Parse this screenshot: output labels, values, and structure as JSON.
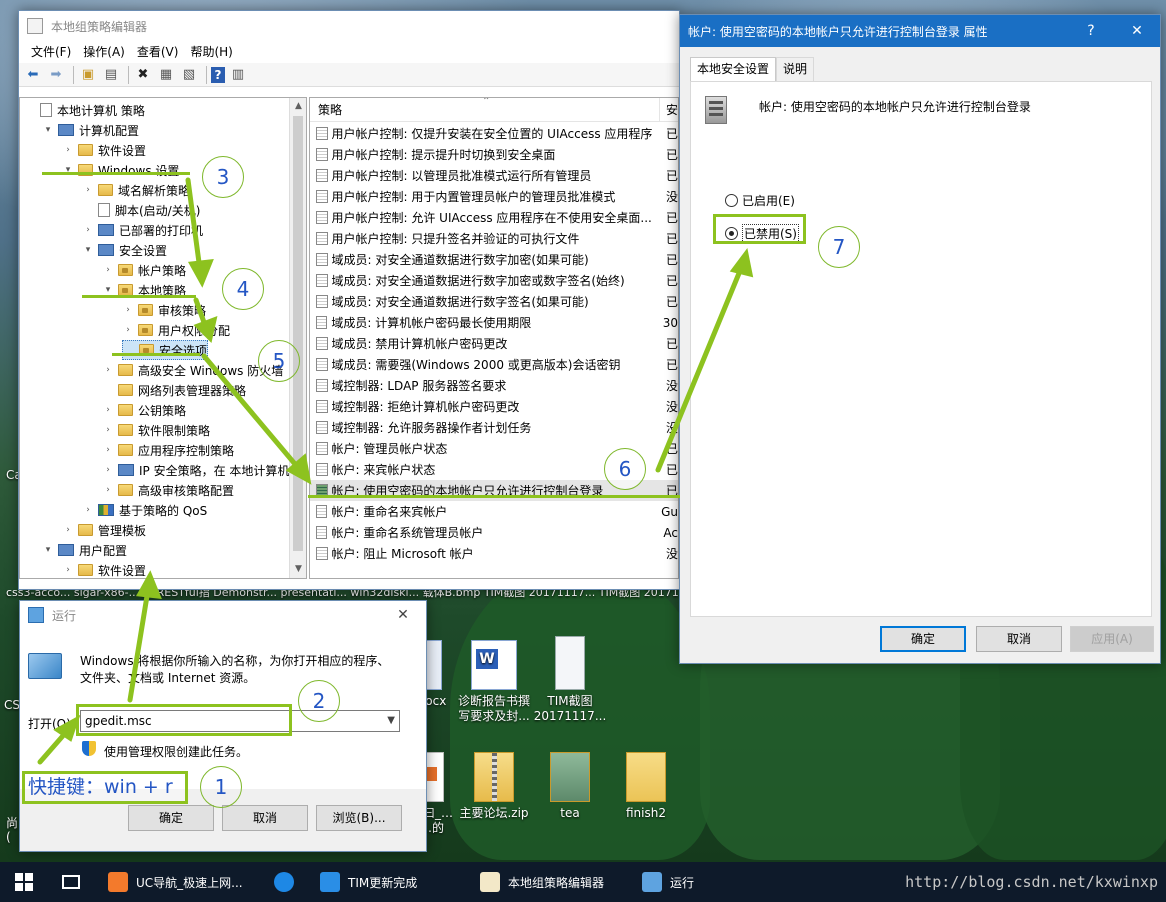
{
  "desktop": {
    "edge_labels": [
      "Ca",
      "CS",
      "尚",
      "("
    ],
    "filename_strip": "css3-acco...   sigar-x86-...04.RESTful指 Demonstr...  presentati...   win32diski...  载体B.bmp   TIM截图 20171117...  TIM截图 20171117...",
    "icons": [
      {
        "label": "docx",
        "icon": "word-doc-icon"
      },
      {
        "label": "诊断报告书撰写要求及封...",
        "icon": "word-doc-icon"
      },
      {
        "label": "TIM截图20171117...",
        "icon": "screenshot-icon"
      },
      {
        "label": "…曰_… …的",
        "icon": "pdf-icon"
      },
      {
        "label": "主要论坛.zip",
        "icon": "zip-folder-icon"
      },
      {
        "label": "tea",
        "icon": "image-folder-icon"
      },
      {
        "label": "finish2",
        "icon": "folder-icon"
      }
    ]
  },
  "gpedit": {
    "title": "本地组策略编辑器",
    "menu": [
      "文件(F)",
      "操作(A)",
      "查看(V)",
      "帮助(H)"
    ],
    "toolbar_icons": [
      "back-icon",
      "forward-icon",
      "up-folder-icon",
      "show-hide-tree-icon",
      "delete-icon",
      "properties-icon",
      "export-icon",
      "help-icon",
      "view-icon"
    ],
    "tree": [
      {
        "label": "本地计算机 策略",
        "level": 0,
        "icon": "doc",
        "expander": ""
      },
      {
        "label": "计算机配置",
        "level": 1,
        "icon": "pc",
        "expander": "v"
      },
      {
        "label": "软件设置",
        "level": 2,
        "icon": "folder",
        "expander": ">"
      },
      {
        "label": "Windows 设置",
        "level": 2,
        "icon": "folder",
        "expander": "v"
      },
      {
        "label": "域名解析策略",
        "level": 3,
        "icon": "folder",
        "expander": ">"
      },
      {
        "label": "脚本(启动/关机)",
        "level": 3,
        "icon": "doc",
        "expander": ""
      },
      {
        "label": "已部署的打印机",
        "level": 3,
        "icon": "pc",
        "expander": ">"
      },
      {
        "label": "安全设置",
        "level": 3,
        "icon": "pc",
        "expander": "v"
      },
      {
        "label": "帐户策略",
        "level": 4,
        "icon": "folder-lock",
        "expander": ">"
      },
      {
        "label": "本地策略",
        "level": 4,
        "icon": "folder-lock",
        "expander": "v"
      },
      {
        "label": "审核策略",
        "level": 5,
        "icon": "folder-lock",
        "expander": ">"
      },
      {
        "label": "用户权限分配",
        "level": 5,
        "icon": "folder-lock",
        "expander": ">"
      },
      {
        "label": "安全选项",
        "level": 5,
        "icon": "folder-lock",
        "expander": "",
        "selected": true
      },
      {
        "label": "高级安全 Windows 防火墙",
        "level": 4,
        "icon": "folder",
        "expander": ">"
      },
      {
        "label": "网络列表管理器策略",
        "level": 4,
        "icon": "folder",
        "expander": ""
      },
      {
        "label": "公钥策略",
        "level": 4,
        "icon": "folder",
        "expander": ">"
      },
      {
        "label": "软件限制策略",
        "level": 4,
        "icon": "folder",
        "expander": ">"
      },
      {
        "label": "应用程序控制策略",
        "level": 4,
        "icon": "folder",
        "expander": ">"
      },
      {
        "label": "IP 安全策略，在 本地计算机",
        "level": 4,
        "icon": "pc",
        "expander": ">"
      },
      {
        "label": "高级审核策略配置",
        "level": 4,
        "icon": "folder",
        "expander": ">"
      },
      {
        "label": "基于策略的 QoS",
        "level": 3,
        "icon": "chart",
        "expander": ">"
      },
      {
        "label": "管理模板",
        "level": 2,
        "icon": "folder",
        "expander": ">"
      },
      {
        "label": "用户配置",
        "level": 1,
        "icon": "pc",
        "expander": "v"
      },
      {
        "label": "软件设置",
        "level": 2,
        "icon": "folder",
        "expander": ">"
      }
    ],
    "list_headers": {
      "policy": "策略",
      "setting": "安"
    },
    "policies": [
      {
        "name": "用户帐户控制: 仅提升安装在安全位置的 UIAccess 应用程序",
        "setting": "已"
      },
      {
        "name": "用户帐户控制: 提示提升时切换到安全桌面",
        "setting": "已"
      },
      {
        "name": "用户帐户控制: 以管理员批准模式运行所有管理员",
        "setting": "已"
      },
      {
        "name": "用户帐户控制: 用于内置管理员帐户的管理员批准模式",
        "setting": "没"
      },
      {
        "name": "用户帐户控制: 允许 UIAccess 应用程序在不使用安全桌面...",
        "setting": "已"
      },
      {
        "name": "用户帐户控制: 只提升签名并验证的可执行文件",
        "setting": "已"
      },
      {
        "name": "域成员: 对安全通道数据进行数字加密(如果可能)",
        "setting": "已"
      },
      {
        "name": "域成员: 对安全通道数据进行数字加密或数字签名(始终)",
        "setting": "已"
      },
      {
        "name": "域成员: 对安全通道数据进行数字签名(如果可能)",
        "setting": "已"
      },
      {
        "name": "域成员: 计算机帐户密码最长使用期限",
        "setting": "30"
      },
      {
        "name": "域成员: 禁用计算机帐户密码更改",
        "setting": "已"
      },
      {
        "name": "域成员: 需要强(Windows 2000 或更高版本)会话密钥",
        "setting": "已"
      },
      {
        "name": "域控制器: LDAP 服务器签名要求",
        "setting": "没"
      },
      {
        "name": "域控制器: 拒绝计算机帐户密码更改",
        "setting": "没"
      },
      {
        "name": "域控制器: 允许服务器操作者计划任务",
        "setting": "没"
      },
      {
        "name": "帐户: 管理员帐户状态",
        "setting": "已"
      },
      {
        "name": "帐户: 来宾帐户状态",
        "setting": "已"
      },
      {
        "name": "帐户: 使用空密码的本地帐户只允许进行控制台登录",
        "setting": "已",
        "selected": true
      },
      {
        "name": "帐户: 重命名来宾帐户",
        "setting": "Gu"
      },
      {
        "name": "帐户: 重命名系统管理员帐户",
        "setting": "Ac"
      },
      {
        "name": "帐户: 阻止 Microsoft 帐户",
        "setting": "没"
      }
    ]
  },
  "properties": {
    "title": "帐户: 使用空密码的本地帐户只允许进行控制台登录 属性",
    "help_glyph": "?",
    "close_glyph": "✕",
    "tabs": [
      "本地安全设置",
      "说明"
    ],
    "heading": "帐户: 使用空密码的本地帐户只允许进行控制台登录",
    "radio_enabled": "已启用(E)",
    "radio_disabled": "已禁用(S)",
    "selected_option": "disabled",
    "ok": "确定",
    "cancel": "取消",
    "apply": "应用(A)"
  },
  "run": {
    "title": "运行",
    "close_glyph": "✕",
    "description": "Windows 将根据你所输入的名称，为你打开相应的程序、文件夹、文档或 Internet 资源。",
    "open_label": "打开(O):",
    "input_value": "gpedit.msc",
    "admin_text": "使用管理权限创建此任务。",
    "ok": "确定",
    "cancel": "取消",
    "browse": "浏览(B)..."
  },
  "annotations": {
    "shortcut": "快捷键：win + r",
    "steps": [
      "1",
      "2",
      "3",
      "4",
      "5",
      "6",
      "7"
    ],
    "accent_color": "#8dc21f",
    "number_color": "#2456c4"
  },
  "taskbar": {
    "items": [
      {
        "label": "UC导航_极速上网...",
        "icon": "uc-browser-icon"
      },
      {
        "label": "",
        "icon": "edge-icon"
      },
      {
        "label": "TIM更新完成",
        "icon": "tim-icon"
      },
      {
        "label": "本地组策略编辑器",
        "icon": "gpedit-icon"
      },
      {
        "label": "运行",
        "icon": "run-icon"
      }
    ],
    "watermark": "http://blog.csdn.net/kxwinxp"
  }
}
